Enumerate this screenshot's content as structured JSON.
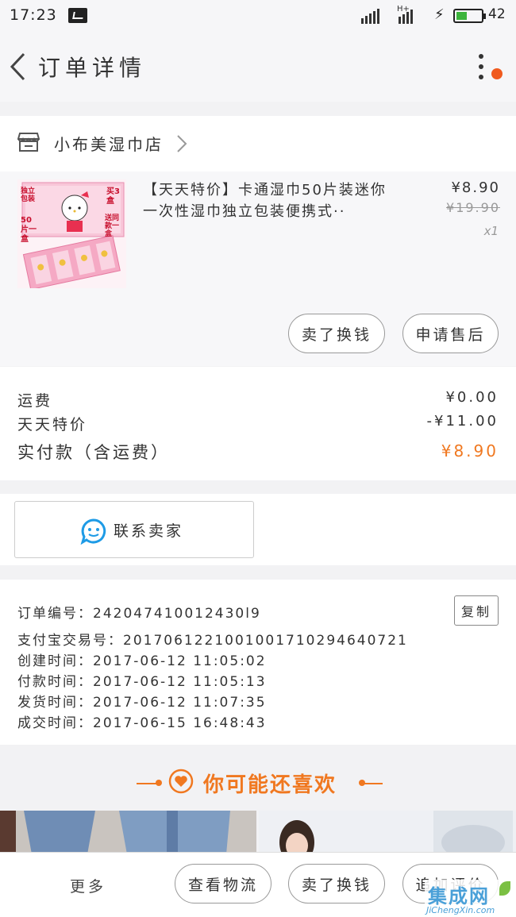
{
  "status_bar": {
    "time": "17:23",
    "network_label": "H+",
    "battery_level": "42",
    "battery_fraction": 0.42
  },
  "header": {
    "title": "订单详情"
  },
  "shop": {
    "name": "小布美湿巾店"
  },
  "product": {
    "title": "【天天特价】卡通湿巾50片装迷你一次性湿巾独立包装便携式··",
    "price": "¥8.90",
    "original_price": "¥19.90",
    "quantity": "x1",
    "image_texts": {
      "top_left": "独立包装",
      "mid_left": "50片一盒",
      "top_right": "买3盒",
      "mid_right": "送同款一盒"
    },
    "actions": {
      "refund": "卖了换钱",
      "after_sale": "申请售后"
    }
  },
  "fees": {
    "shipping_label": "运费",
    "shipping_value": "¥0.00",
    "discount_label": "天天特价",
    "discount_value": "-¥11.00",
    "total_label": "实付款（含运费）",
    "total_value": "¥8.90",
    "total_color": "#f07820"
  },
  "contact": {
    "label": "联系卖家"
  },
  "order_info": {
    "order_no": "订单编号：242047410012430l9",
    "alipay_no": "支付宝交易号：2017061221001001710294640721",
    "created": "创建时间：2017-06-12  11:05:02",
    "paid": "付款时间：2017-06-12  11:05:13",
    "shipped": "发货时间：2017-06-12  11:07:35",
    "completed": "成交时间：2017-06-15  16:48:43",
    "copy_label": "复制"
  },
  "recommend": {
    "title": "你可能还喜欢"
  },
  "bottom_bar": {
    "more": "更多",
    "logistics": "查看物流",
    "sell": "卖了换钱",
    "review": "追加评价"
  },
  "watermark": {
    "text": "集成网",
    "url_text": "JiChengXin.com"
  },
  "colors": {
    "accent": "#f07820",
    "notification": "#f05a1e",
    "contact_icon": "#1e9be6"
  }
}
